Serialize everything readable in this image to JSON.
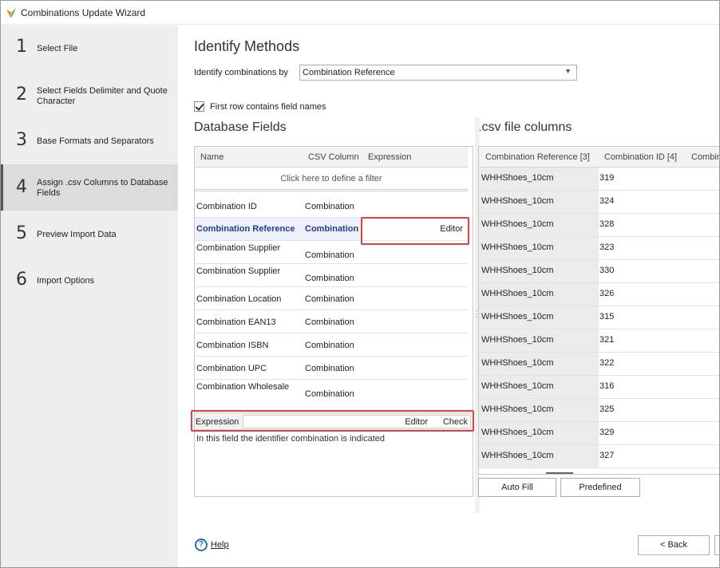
{
  "window": {
    "title": "Combinations Update Wizard"
  },
  "steps": [
    {
      "num": "1",
      "label": "Select File"
    },
    {
      "num": "2",
      "label": "Select Fields Delimiter and Quote Character"
    },
    {
      "num": "3",
      "label": "Base Formats and Separators"
    },
    {
      "num": "4",
      "label": "Assign .csv Columns to Database Fields"
    },
    {
      "num": "5",
      "label": "Preview Import Data"
    },
    {
      "num": "6",
      "label": "Import Options"
    }
  ],
  "main": {
    "heading": "Identify Methods",
    "identify_label": "Identify combinations by",
    "identify_value": "Combination Reference",
    "first_row_label": "First row contains field names",
    "first_row_checked": true
  },
  "db_fields": {
    "title": "Database Fields",
    "columns": [
      "Name",
      "CSV Column",
      "Expression"
    ],
    "filter_text": "Click here to define a filter",
    "rows": [
      {
        "name": "Combination ID",
        "csv": "Combination"
      },
      {
        "name": "Combination Reference",
        "csv": "Combination",
        "expression": "Editor"
      },
      {
        "name": "Combination Supplier",
        "csv": "Combination"
      },
      {
        "name": "Combination Supplier",
        "csv": "Combination"
      },
      {
        "name": "Combination Location",
        "csv": "Combination"
      },
      {
        "name": "Combination EAN13",
        "csv": "Combination"
      },
      {
        "name": "Combination ISBN",
        "csv": "Combination"
      },
      {
        "name": "Combination UPC",
        "csv": "Combination"
      },
      {
        "name": "Combination Wholesale",
        "csv": "Combination"
      }
    ],
    "expression_label": "Expression",
    "expression_editor": "Editor",
    "expression_check": "Check",
    "description": "In this field the identifier combination is indicated"
  },
  "csv_columns": {
    "title": ".csv file columns",
    "columns": [
      "Combination Reference [3]",
      "Combination ID [4]",
      "Combin"
    ],
    "rows": [
      {
        "ref": "WHHShoes_10cm",
        "id": "319"
      },
      {
        "ref": "WHHShoes_10cm",
        "id": "324"
      },
      {
        "ref": "WHHShoes_10cm",
        "id": "328"
      },
      {
        "ref": "WHHShoes_10cm",
        "id": "323"
      },
      {
        "ref": "WHHShoes_10cm",
        "id": "330"
      },
      {
        "ref": "WHHShoes_10cm",
        "id": "326"
      },
      {
        "ref": "WHHShoes_10cm",
        "id": "315"
      },
      {
        "ref": "WHHShoes_10cm",
        "id": "321"
      },
      {
        "ref": "WHHShoes_10cm",
        "id": "322"
      },
      {
        "ref": "WHHShoes_10cm",
        "id": "316"
      },
      {
        "ref": "WHHShoes_10cm",
        "id": "325"
      },
      {
        "ref": "WHHShoes_10cm",
        "id": "329"
      },
      {
        "ref": "WHHShoes_10cm",
        "id": "327"
      }
    ]
  },
  "buttons": {
    "auto_fill": "Auto Fill",
    "predefined": "Predefined",
    "help": "Help",
    "back": "< Back"
  },
  "colors": {
    "highlight_border": "#e04040",
    "selected_text": "#2a3a8c",
    "sidebar_bg": "#eeeeee",
    "active_step_bg": "#dcdcdc"
  }
}
